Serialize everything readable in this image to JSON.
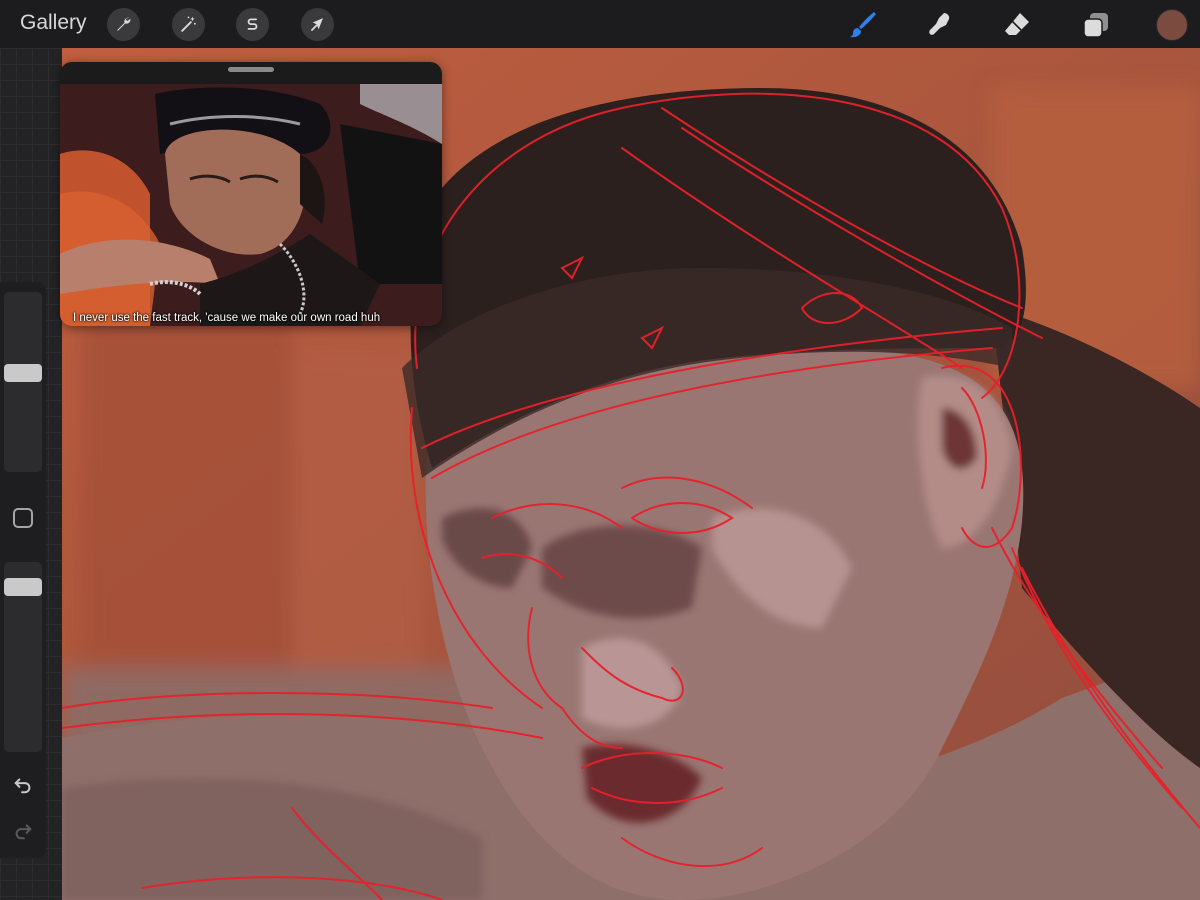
{
  "toolbar": {
    "gallery_label": "Gallery",
    "left_tools": [
      {
        "name": "actions",
        "icon": "wrench-icon"
      },
      {
        "name": "adjustments",
        "icon": "magic-wand-icon"
      },
      {
        "name": "selection",
        "icon": "s-selection-icon"
      },
      {
        "name": "transform",
        "icon": "arrow-cursor-icon"
      }
    ],
    "right_tools": [
      {
        "name": "brush",
        "icon": "brush-icon",
        "active": true
      },
      {
        "name": "smudge",
        "icon": "smudge-icon",
        "active": false
      },
      {
        "name": "eraser",
        "icon": "eraser-icon",
        "active": false
      },
      {
        "name": "layers",
        "icon": "layers-icon",
        "active": false
      }
    ],
    "current_color": "#7a4b3e",
    "active_tool_color": "#2f80ed"
  },
  "sidebar": {
    "brush_size_icon": "slider-knob",
    "opacity_icon": "slider-knob",
    "modify_icon": "square-modify-icon",
    "undo_icon": "undo-icon",
    "redo_icon": "redo-icon"
  },
  "reference": {
    "caption": "I never use the fast track, 'cause we make our own road huh"
  },
  "colors": {
    "background_orange": "#b25a3c",
    "sketch_red": "#e8202a",
    "hair": "#2a1e1c",
    "skin": "#9b7470"
  }
}
